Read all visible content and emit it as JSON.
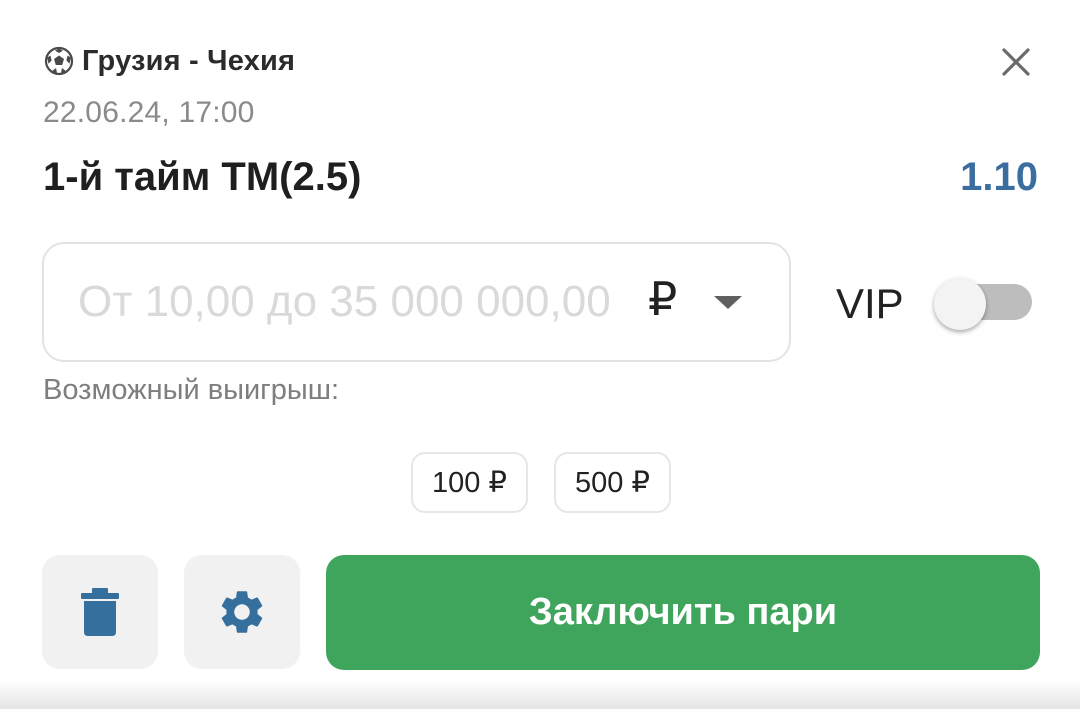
{
  "match": {
    "title": "Грузия - Чехия",
    "icon": "soccer-ball-icon",
    "datetime": "22.06.24,  17:00"
  },
  "bet": {
    "market": "1-й тайм ТМ(2.5)",
    "odds": "1.10"
  },
  "stake": {
    "value": "",
    "placeholder": "От 10,00 до 35 000 000,00",
    "currency": "₽"
  },
  "vip": {
    "label": "VIP",
    "enabled": false
  },
  "possible_win_label": "Возможный выигрыш:",
  "quick_stakes": [
    "100 ₽",
    "500 ₽"
  ],
  "actions": {
    "delete_icon": "trash-icon",
    "settings_icon": "gear-icon",
    "submit_label": "Заключить пари"
  },
  "colors": {
    "odds": "#3b6e9e",
    "submit": "#3fa45c",
    "icon_blue": "#346f9e"
  }
}
